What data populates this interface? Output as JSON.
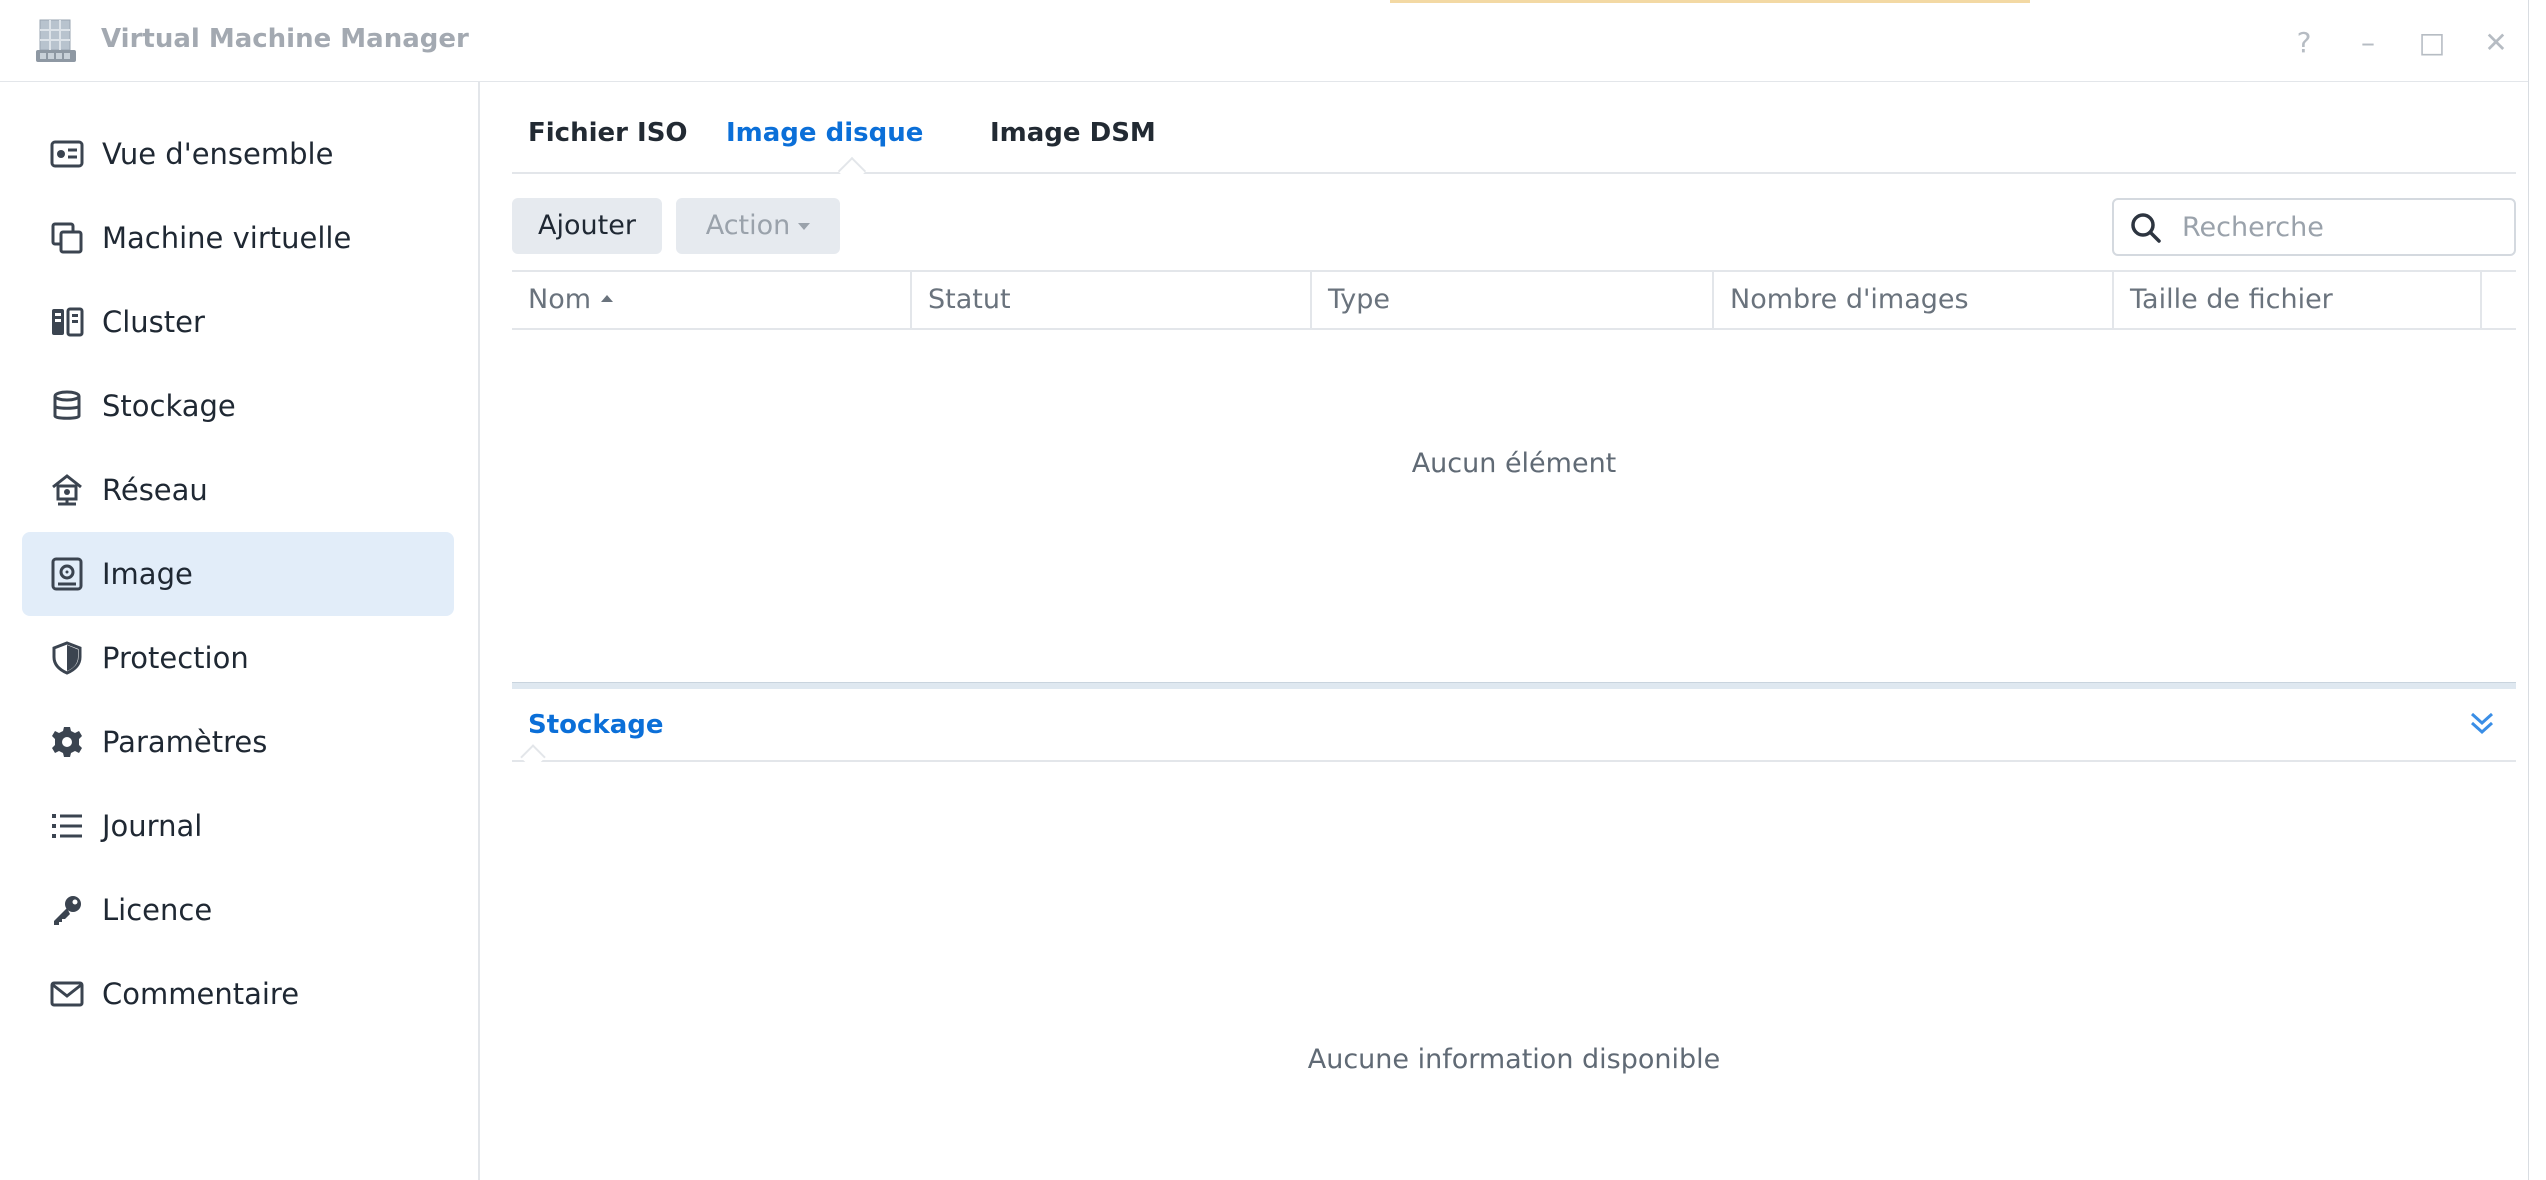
{
  "window": {
    "title": "Virtual Machine Manager"
  },
  "window_controls": [
    "?",
    "–",
    "□",
    "✕"
  ],
  "sidebar": {
    "items": [
      {
        "label": "Vue d'ensemble",
        "icon": "overview-icon"
      },
      {
        "label": "Machine virtuelle",
        "icon": "vm-icon"
      },
      {
        "label": "Cluster",
        "icon": "cluster-icon"
      },
      {
        "label": "Stockage",
        "icon": "storage-icon"
      },
      {
        "label": "Réseau",
        "icon": "network-icon"
      },
      {
        "label": "Image",
        "icon": "image-icon",
        "active": true
      },
      {
        "label": "Protection",
        "icon": "shield-icon"
      },
      {
        "label": "Paramètres",
        "icon": "gear-icon"
      },
      {
        "label": "Journal",
        "icon": "list-icon"
      },
      {
        "label": "Licence",
        "icon": "key-icon"
      },
      {
        "label": "Commentaire",
        "icon": "mail-icon"
      }
    ]
  },
  "tabs": [
    {
      "label": "Fichier ISO"
    },
    {
      "label": "Image disque",
      "active": true
    },
    {
      "label": "Image DSM"
    }
  ],
  "toolbar": {
    "add_label": "Ajouter",
    "action_label": "Action",
    "search_placeholder": "Recherche"
  },
  "table": {
    "columns": [
      "Nom",
      "Statut",
      "Type",
      "Nombre d'images",
      "Taille de fichier"
    ],
    "sort_column": "Nom",
    "empty_message": "Aucun élément"
  },
  "details_panel": {
    "title": "Stockage",
    "empty_message": "Aucune information disponible"
  },
  "colors": {
    "accent": "#0b6fd8",
    "active_bg": "#e2edf9"
  }
}
